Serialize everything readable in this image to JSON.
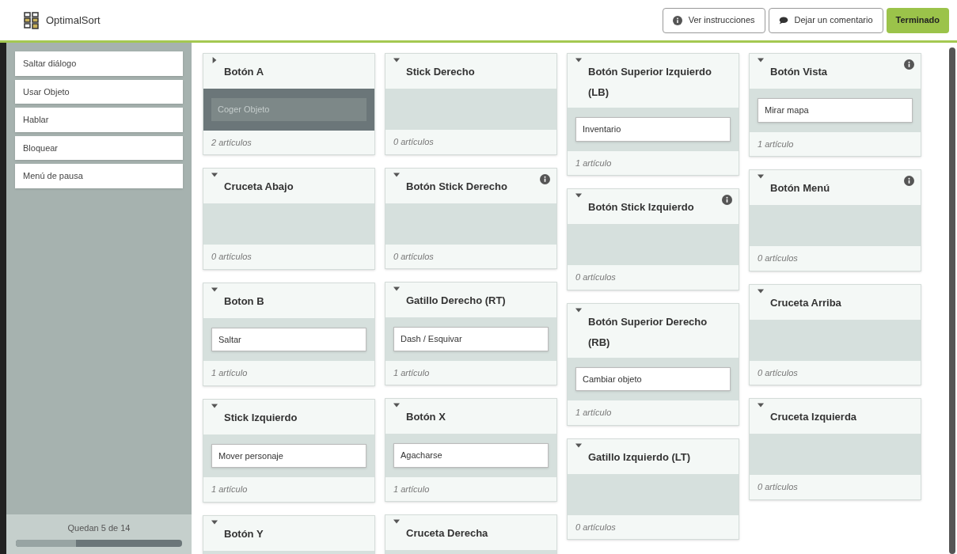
{
  "header": {
    "app_name": "OptimalSort",
    "buttons": [
      {
        "kind": "info",
        "label": "Ver instrucciones"
      },
      {
        "kind": "comment",
        "label": "Dejar un comentario"
      },
      {
        "kind": "primary",
        "label": "Terminado"
      }
    ]
  },
  "sidebar": {
    "items": [
      "Saltar diálogo",
      "Usar Objeto",
      "Hablar",
      "Bloquear",
      "Menú de pausa"
    ],
    "remaining": "Quedan 5 de 14",
    "level": 0.36
  },
  "columns": [
    [
      {
        "title": "Botón A",
        "expanded": false,
        "info": false,
        "items": [
          "Coger Objeto"
        ],
        "count": "2 artículos"
      },
      {
        "title": "Cruceta Abajo",
        "expanded": true,
        "info": false,
        "count": "0 artículos"
      },
      {
        "title": "Boton B",
        "expanded": true,
        "info": false,
        "items": [
          "Saltar"
        ],
        "count": "1 artículo"
      },
      {
        "title": "Stick Izquierdo",
        "expanded": true,
        "info": false,
        "items": [
          "Mover personaje"
        ],
        "count": "1 artículo"
      },
      {
        "title": "Botón Y",
        "expanded": true,
        "info": false
      }
    ],
    [
      {
        "title": "Stick Derecho",
        "expanded": true,
        "info": false,
        "count": "0 artículos"
      },
      {
        "title": "Botón Stick Derecho",
        "expanded": true,
        "info": true,
        "count": "0 artículos"
      },
      {
        "title": "Gatillo Derecho (RT)",
        "expanded": true,
        "info": false,
        "items": [
          "Dash / Esquivar"
        ],
        "count": "1 artículo"
      },
      {
        "title": "Botón X",
        "expanded": true,
        "info": false,
        "items": [
          "Agacharse"
        ],
        "count": "1 artículo"
      },
      {
        "title": "Cruceta Derecha",
        "expanded": true,
        "info": false
      }
    ],
    [
      {
        "title": "Botón Superior Izquierdo (LB)",
        "expanded": true,
        "info": false,
        "items": [
          "Inventario"
        ],
        "count": "1 artículo"
      },
      {
        "title": "Botón Stick Izquierdo",
        "expanded": true,
        "info": true,
        "count": "0 artículos"
      },
      {
        "title": "Botón Superior Derecho (RB)",
        "expanded": true,
        "info": false,
        "items": [
          "Cambiar objeto"
        ],
        "count": "1 artículo"
      },
      {
        "title": "Gatillo Izquierdo (LT)",
        "expanded": true,
        "info": false,
        "count": "0 artículos"
      }
    ],
    [
      {
        "title": "Botón Vista",
        "expanded": true,
        "info": true,
        "items": [
          "Mirar mapa"
        ],
        "count": "1 artículo"
      },
      {
        "title": "Botón Menú",
        "expanded": true,
        "info": true,
        "count": "0 artículos"
      },
      {
        "title": "Cruceta Arriba",
        "expanded": true,
        "info": false,
        "count": "0 artículos"
      },
      {
        "title": "Cruceta Izquierda",
        "expanded": true,
        "info": false,
        "count": "0 artículos"
      }
    ]
  ]
}
